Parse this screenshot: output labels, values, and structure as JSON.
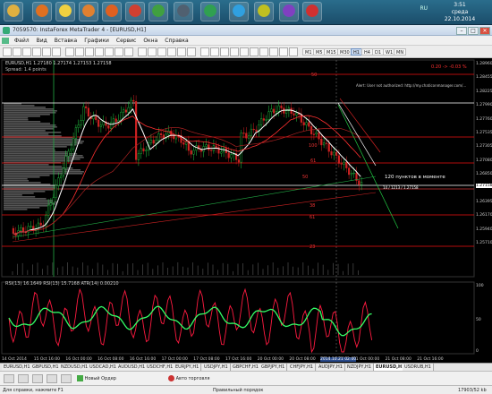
{
  "taskbar": {
    "apps": [
      {
        "name": "folder-icon",
        "color": "#e0b040"
      },
      {
        "name": "shield-icon",
        "color": "#e07020"
      },
      {
        "name": "notes-icon",
        "color": "#f0d040"
      },
      {
        "name": "shell-icon",
        "color": "#e08030"
      },
      {
        "name": "firefox-icon",
        "color": "#e06020"
      },
      {
        "name": "office-icon",
        "color": "#d04030"
      },
      {
        "name": "chrome-icon",
        "color": "#40a040"
      },
      {
        "name": "monitor-icon",
        "color": "#506070"
      },
      {
        "name": "globe-icon",
        "color": "#30a050"
      },
      {
        "name": "skype-icon",
        "color": "#30a0e0"
      },
      {
        "name": "edit-icon",
        "color": "#c0c020"
      },
      {
        "name": "viber-icon",
        "color": "#8040c0"
      },
      {
        "name": "flashget-icon",
        "color": "#d03030"
      }
    ],
    "tray_lang": "RU",
    "clock": {
      "time": "3:51",
      "day": "среда",
      "date": "22.10.2014"
    }
  },
  "window": {
    "title": "7059570: InstaForex MetaTrader 4 - [EURUSD,H1]"
  },
  "menu": {
    "items": [
      "Файл",
      "Вид",
      "Вставка",
      "Графики",
      "Сервис",
      "Окна",
      "Справка"
    ]
  },
  "toolbar": {
    "timeframes": [
      "M1",
      "M5",
      "M15",
      "M30",
      "H1",
      "H4",
      "D1",
      "W1",
      "MN"
    ],
    "selected_timeframe": "H1"
  },
  "chart": {
    "symbol_label": "EURUSD,H1 1.27180 1.27174 1.27153 1.27158",
    "spread_label": "Spread: 1.4 points",
    "pct_label": "0.20 -> -0.03 %",
    "alert_label": "Alert: User not authorized: http://my.chaticonmanager.com/...",
    "annotation": "120 пунктов в моменте",
    "price_box": "14 / 1213 / 1.27158",
    "level_labels": [
      "50",
      "100",
      "61",
      "50",
      "38",
      "61",
      "23"
    ],
    "price_axis": [
      "1.28960",
      "1.28455",
      "1.28225",
      "1.27990",
      "1.27760",
      "1.27535",
      "1.27305",
      "1.27080",
      "1.26850",
      "1.26625",
      "1.26395",
      "1.26170",
      "1.25940",
      "1.25710"
    ],
    "current_price": "1.27158",
    "time_axis": [
      "14 Oct 2014",
      "15 Oct 16:00",
      "16 Oct 00:00",
      "16 Oct 08:00",
      "16 Oct 16:00",
      "17 Oct 00:00",
      "17 Oct 08:00",
      "17 Oct 16:00",
      "20 Oct 00:00",
      "20 Oct 08:00",
      "20 Oct 16:00",
      "21 Oct 00:00",
      "21 Oct 08:00",
      "21 Oct 16:00"
    ],
    "time_highlight": "2014.10.21 02:00",
    "indicator_label": "RSI(13) 16.1649  RSI(13) 15.7168  ATR(14) 0.00210",
    "indicator_axis": [
      "100",
      "50",
      "0"
    ]
  },
  "chart_tabs": [
    "EURUSD,H1",
    "GBPUSD,H1",
    "NZDUSD,H1",
    "USDCAD,H1",
    "AUDUSD,H1",
    "USDCHF,H1",
    "EURJPY,H1",
    "USDJPY,H1",
    "GBPCHF,H1",
    "GBPJPY,H1",
    "CHFJPY,H1",
    "AUDJPY,H1",
    "NZDJPY,H1",
    "EURUSD,H1",
    "USDRUB,H1"
  ],
  "active_tab_index": 13,
  "bottom_bar": {
    "new_order": "Новый Ордер",
    "autotrade": "Авто торговля"
  },
  "status": {
    "help": "Для справки, нажмите F1",
    "profile": "Правильный порядок",
    "traffic": "17903/52 kb"
  },
  "colors": {
    "bg": "#000000",
    "bull": "#22cc44",
    "bear": "#cc2222",
    "ma_white": "#ffffff",
    "ma_red": "#ff3030",
    "level_red": "#ee1111",
    "rsi_red": "#ff1a40",
    "rsi_green": "#33ff66"
  }
}
